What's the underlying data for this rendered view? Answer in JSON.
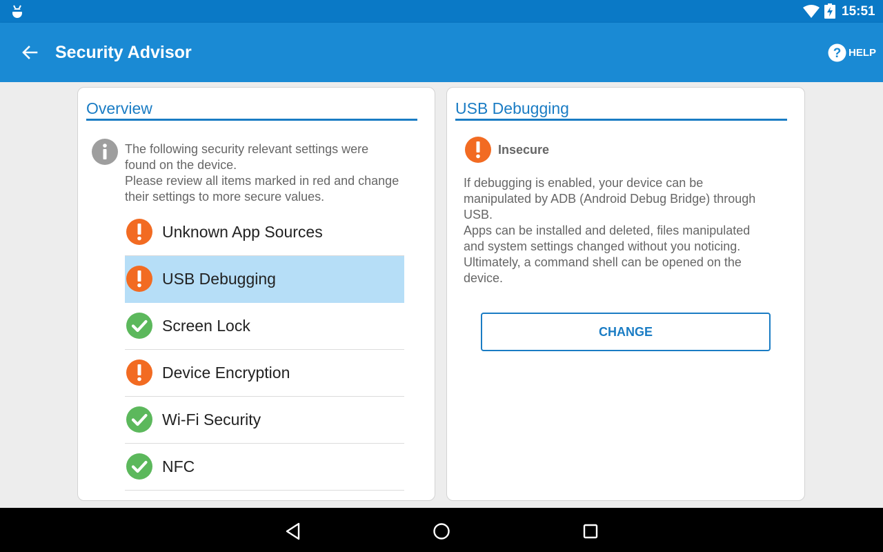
{
  "status_bar": {
    "time": "15:51"
  },
  "app_bar": {
    "title": "Security Advisor",
    "help_label": "HELP"
  },
  "overview": {
    "title": "Overview",
    "intro": "The following security relevant settings were\nfound on the device.\nPlease review all items marked in red and change\ntheir settings to more secure values.",
    "items": [
      {
        "label": "Unknown App Sources",
        "status": "warning",
        "selected": false
      },
      {
        "label": "USB Debugging",
        "status": "warning",
        "selected": true
      },
      {
        "label": "Screen Lock",
        "status": "ok",
        "selected": false
      },
      {
        "label": "Device Encryption",
        "status": "warning",
        "selected": false
      },
      {
        "label": "Wi-Fi Security",
        "status": "ok",
        "selected": false
      },
      {
        "label": "NFC",
        "status": "ok",
        "selected": false
      }
    ]
  },
  "detail": {
    "title": "USB Debugging",
    "status": "Insecure",
    "description": "If debugging is enabled, your device can be\nmanipulated by ADB (Android Debug Bridge) through\nUSB.\n Apps can be installed and deleted, files manipulated\nand system settings changed without you noticing.\nUltimately, a command shell can be opened on the\ndevice.",
    "button_label": "CHANGE"
  },
  "colors": {
    "primary": "#1a8ad4",
    "status_bar": "#0a79c6",
    "accent": "#1a7cc4",
    "warning": "#f26b22",
    "ok": "#5cb85c",
    "selected": "#b6def7"
  }
}
